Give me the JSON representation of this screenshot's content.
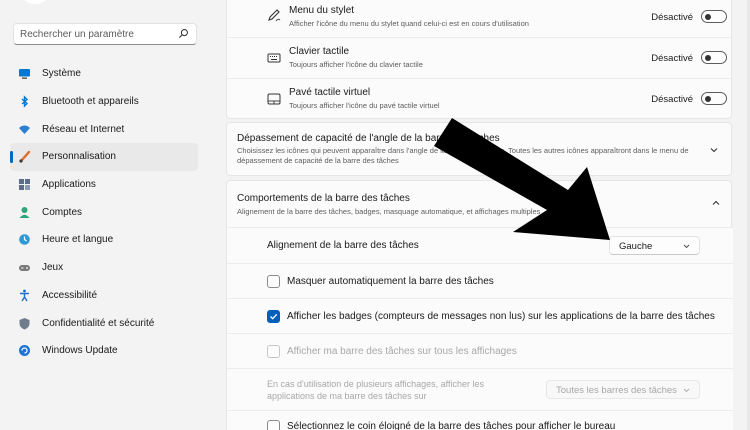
{
  "sidebar": {
    "search_placeholder": "Rechercher un paramètre",
    "items": [
      {
        "label": "Système",
        "icon": "monitor-icon"
      },
      {
        "label": "Bluetooth et appareils",
        "icon": "bluetooth-icon"
      },
      {
        "label": "Réseau et Internet",
        "icon": "wifi-icon"
      },
      {
        "label": "Personnalisation",
        "icon": "brush-icon",
        "active": true
      },
      {
        "label": "Applications",
        "icon": "apps-icon"
      },
      {
        "label": "Comptes",
        "icon": "account-icon"
      },
      {
        "label": "Heure et langue",
        "icon": "globe-clock-icon"
      },
      {
        "label": "Jeux",
        "icon": "gamepad-icon"
      },
      {
        "label": "Accessibilité",
        "icon": "accessibility-icon"
      },
      {
        "label": "Confidentialité et sécurité",
        "icon": "shield-icon"
      },
      {
        "label": "Windows Update",
        "icon": "update-icon"
      }
    ]
  },
  "corner_icons": {
    "stylus": {
      "title": "Menu du stylet",
      "subtitle": "Afficher l'icône du menu du stylet quand celui-ci est en cours d'utilisation",
      "status": "Désactivé"
    },
    "keyboard": {
      "title": "Clavier tactile",
      "subtitle": "Toujours afficher l'icône du clavier tactile",
      "status": "Désactivé"
    },
    "touchpad": {
      "title": "Pavé tactile virtuel",
      "subtitle": "Toujours afficher l'icône du pavé tactile virtuel",
      "status": "Désactivé"
    }
  },
  "overflow": {
    "title": "Dépassement de capacité de l'angle de la barre des tâches",
    "subtitle": "Choisissez les icônes qui peuvent apparaître dans l'angle de la barre des tâches. Toutes les autres icônes apparaîtront dans le menu de dépassement de capacité de la barre des tâches"
  },
  "behaviors": {
    "title": "Comportements de la barre des tâches",
    "subtitle": "Alignement de la barre des tâches, badges, masquage automatique, et affichages multiples",
    "alignment_label": "Alignement de la barre des tâches",
    "alignment_value": "Gauche",
    "autohide_label": "Masquer automatiquement la barre des tâches",
    "badges_label": "Afficher les badges (compteurs de messages non lus) sur les applications de la barre des tâches",
    "all_displays_label": "Afficher ma barre des tâches sur tous les affichages",
    "multi_display_label": "En cas d'utilisation de plusieurs affichages, afficher les applications de ma barre des tâches sur",
    "multi_display_value": "Toutes les barres des tâches",
    "far_corner_label": "Sélectionnez le coin éloigné de la barre des tâches pour afficher le bureau"
  },
  "colors": {
    "accent": "#0067c0",
    "checkbox_checked": "#005fb8"
  }
}
